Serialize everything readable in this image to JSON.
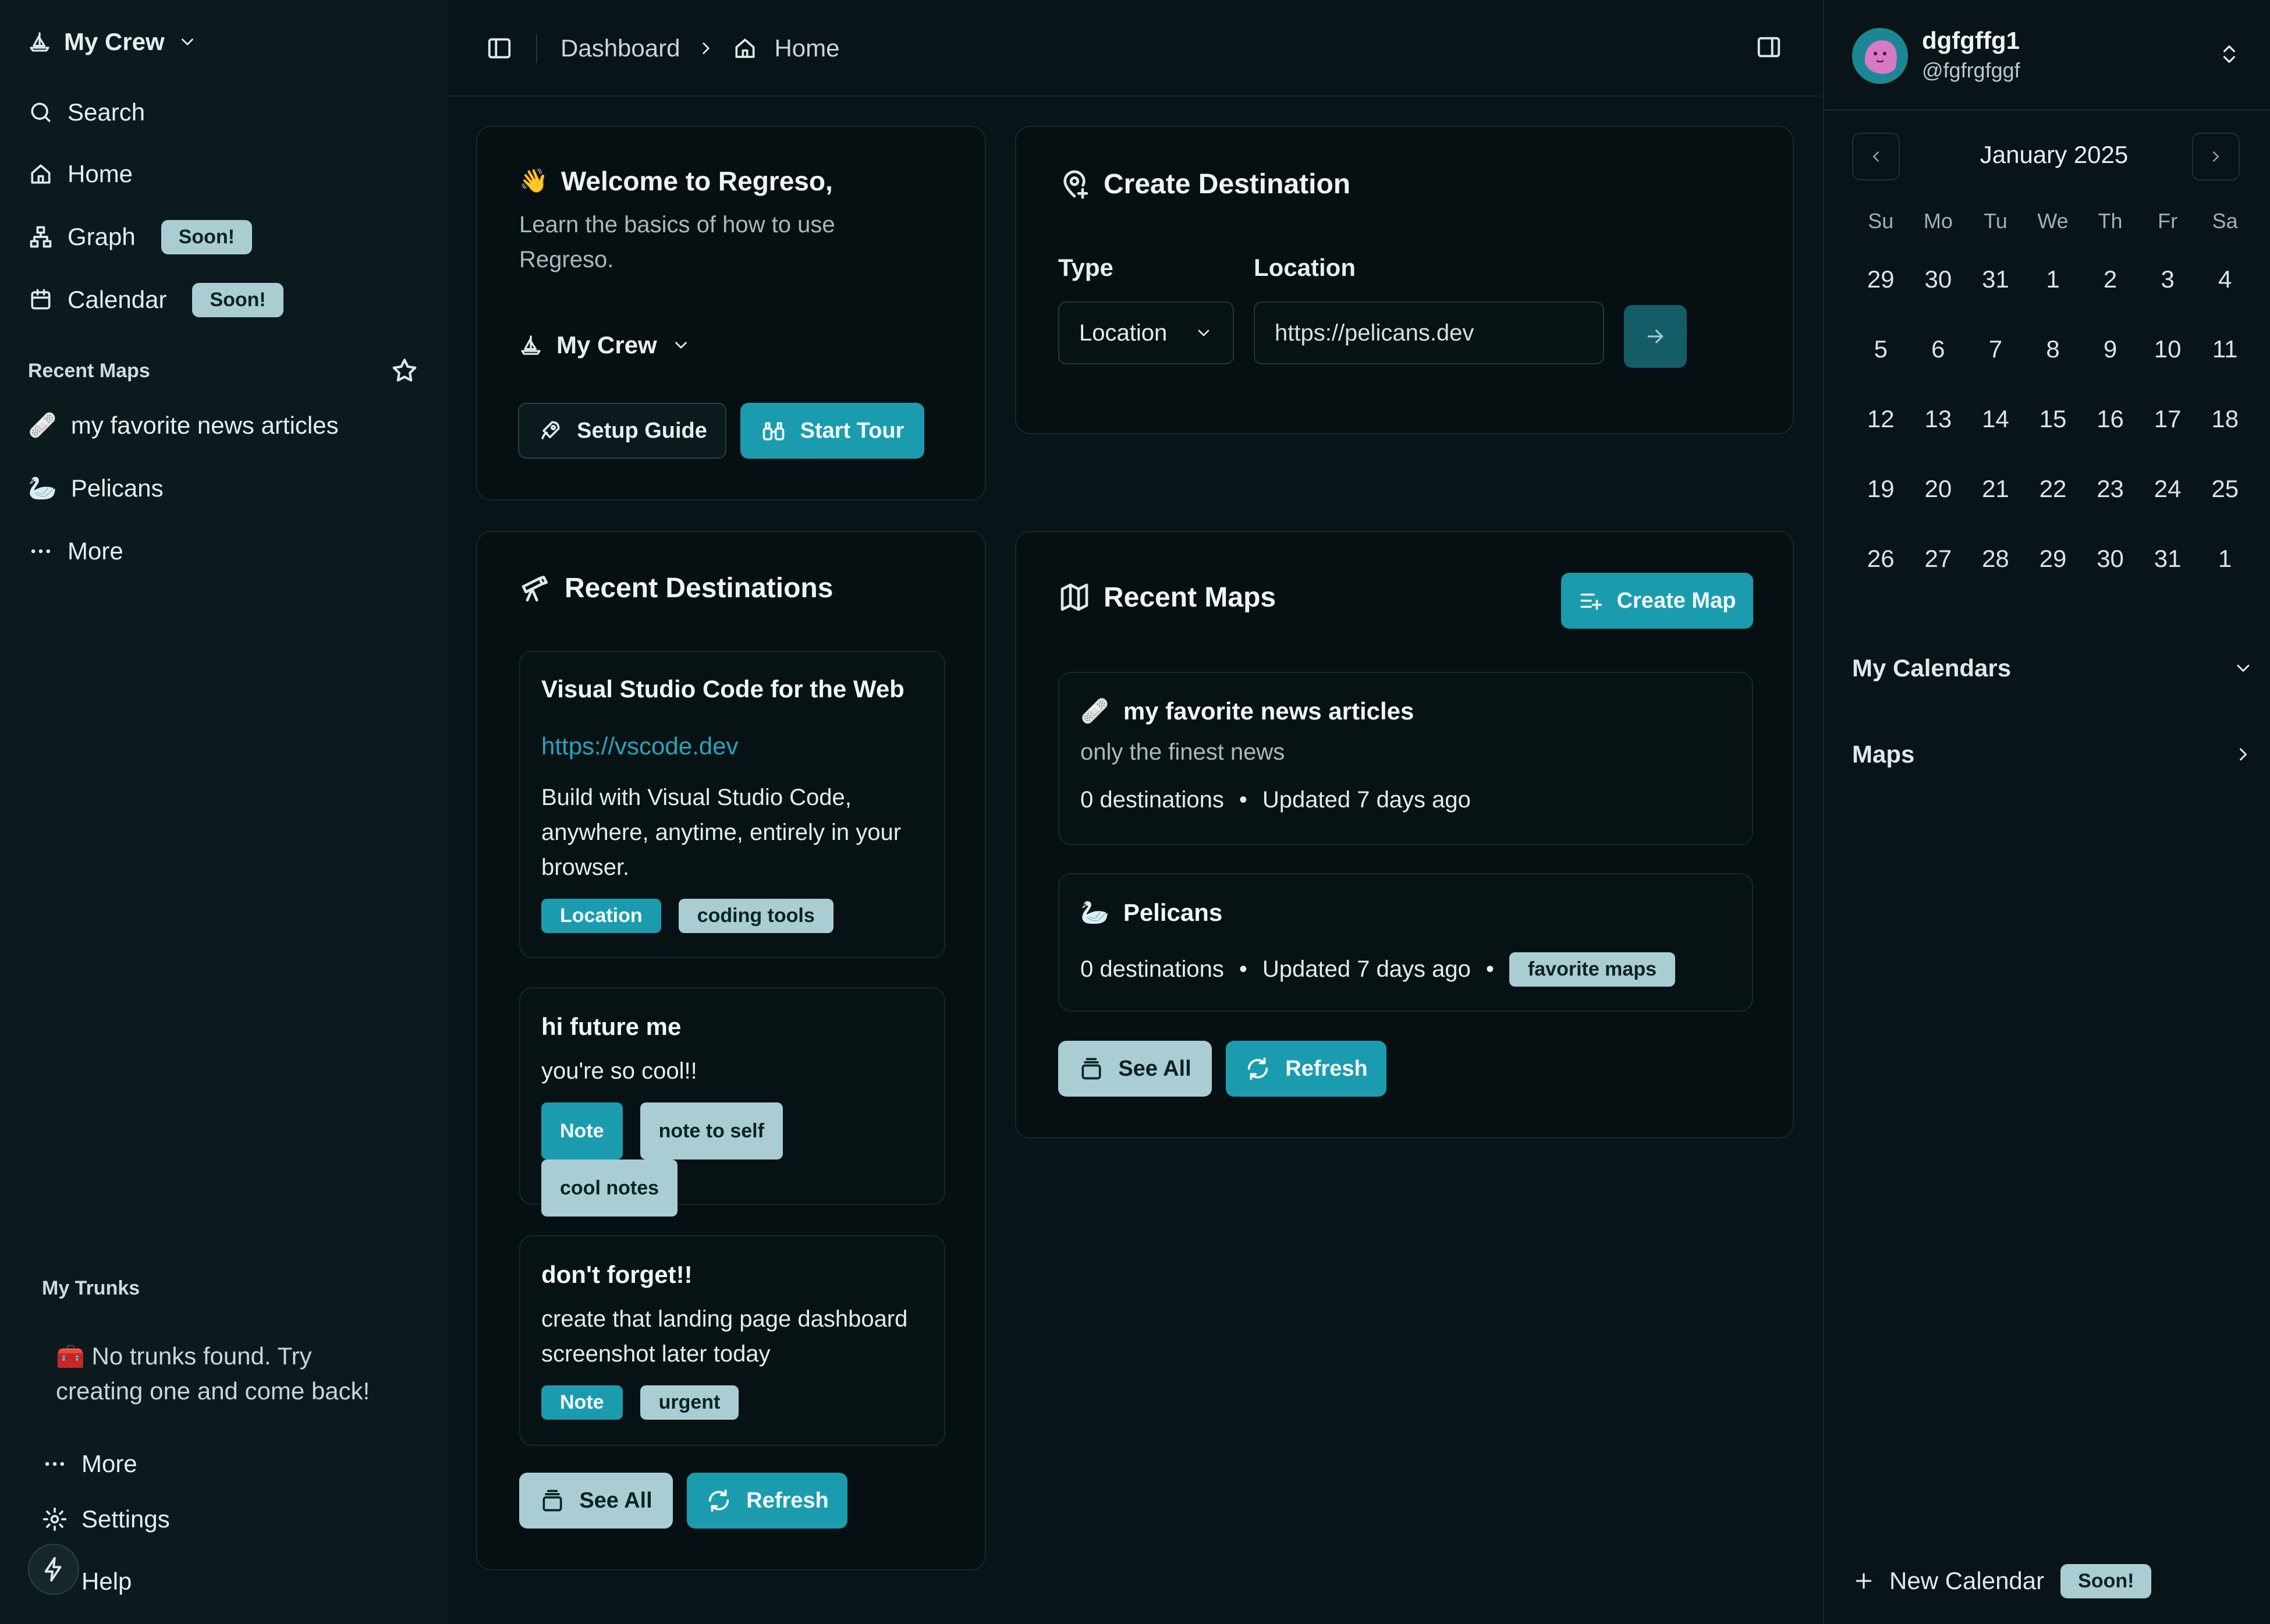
{
  "sidebar": {
    "crew_name": "My Crew",
    "nav": [
      {
        "label": "Search",
        "icon": "search-icon"
      },
      {
        "label": "Home",
        "icon": "home-icon"
      },
      {
        "label": "Graph",
        "icon": "graph-icon",
        "badge": "Soon!"
      },
      {
        "label": "Calendar",
        "icon": "calendar-icon",
        "badge": "Soon!"
      }
    ],
    "recent_maps_label": "Recent Maps",
    "recent_maps": [
      {
        "emoji": "🩹",
        "label": "my favorite news articles"
      },
      {
        "emoji": "🦢",
        "label": "Pelicans"
      }
    ],
    "more_label": "More",
    "trunks_label": "My Trunks",
    "trunks_empty_emoji": "🧰",
    "trunks_empty": "No trunks found. Try creating one and come back!",
    "bottom_more": "More",
    "settings": "Settings",
    "help": "Help"
  },
  "topbar": {
    "crumb_1": "Dashboard",
    "crumb_2": "Home"
  },
  "welcome": {
    "emoji": "👋",
    "title": "Welcome to Regreso,",
    "subtitle": "Learn the basics of how to use Regreso.",
    "crew_label": "My Crew",
    "setup_guide": "Setup Guide",
    "start_tour": "Start Tour"
  },
  "create_destination": {
    "title": "Create Destination",
    "type_label": "Type",
    "type_value": "Location",
    "location_label": "Location",
    "location_value": "https://pelicans.dev"
  },
  "recent_destinations": {
    "title": "Recent Destinations",
    "items": [
      {
        "title": "Visual Studio Code for the Web",
        "url": "https://vscode.dev",
        "text": "Build with Visual Studio Code, anywhere, anytime, entirely in your browser.",
        "tags": [
          "Location",
          "coding tools"
        ]
      },
      {
        "title": "hi future me",
        "text": "you're so cool!!",
        "tags": [
          "Note",
          "note to self",
          "cool notes"
        ]
      },
      {
        "title": "don't forget!!",
        "text": "create that landing page dashboard screenshot later today",
        "tags": [
          "Note",
          "urgent"
        ]
      }
    ],
    "see_all": "See All",
    "refresh": "Refresh"
  },
  "recent_maps": {
    "title": "Recent Maps",
    "create_map": "Create Map",
    "items": [
      {
        "emoji": "🩹",
        "title": "my favorite news articles",
        "description": "only the finest news",
        "destinations": "0 destinations",
        "updated": "Updated 7 days ago"
      },
      {
        "emoji": "🦢",
        "title": "Pelicans",
        "destinations": "0 destinations",
        "updated": "Updated 7 days ago",
        "tag": "favorite maps"
      }
    ],
    "see_all": "See All",
    "refresh": "Refresh"
  },
  "user": {
    "name": "dgfgffg1",
    "handle": "@fgfrgfggf"
  },
  "calendar": {
    "month": "January 2025",
    "weekdays": [
      "Su",
      "Mo",
      "Tu",
      "We",
      "Th",
      "Fr",
      "Sa"
    ],
    "days": [
      "29",
      "30",
      "31",
      "1",
      "2",
      "3",
      "4",
      "5",
      "6",
      "7",
      "8",
      "9",
      "10",
      "11",
      "12",
      "13",
      "14",
      "15",
      "16",
      "17",
      "18",
      "19",
      "20",
      "21",
      "22",
      "23",
      "24",
      "25",
      "26",
      "27",
      "28",
      "29",
      "30",
      "31",
      "1"
    ],
    "my_calendars": "My Calendars",
    "maps": "Maps",
    "new_calendar": "New Calendar",
    "new_calendar_badge": "Soon!"
  },
  "colors": {
    "accent": "#1b9cae",
    "badge": "#a9cdd2",
    "background": "#081417",
    "card": "#061013"
  }
}
